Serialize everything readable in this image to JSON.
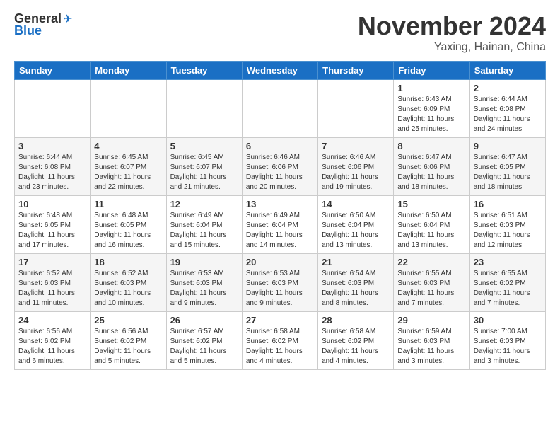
{
  "header": {
    "logo_general": "General",
    "logo_blue": "Blue",
    "title": "November 2024",
    "location": "Yaxing, Hainan, China"
  },
  "weekdays": [
    "Sunday",
    "Monday",
    "Tuesday",
    "Wednesday",
    "Thursday",
    "Friday",
    "Saturday"
  ],
  "weeks": [
    [
      {
        "day": "",
        "info": ""
      },
      {
        "day": "",
        "info": ""
      },
      {
        "day": "",
        "info": ""
      },
      {
        "day": "",
        "info": ""
      },
      {
        "day": "",
        "info": ""
      },
      {
        "day": "1",
        "info": "Sunrise: 6:43 AM\nSunset: 6:09 PM\nDaylight: 11 hours and 25 minutes."
      },
      {
        "day": "2",
        "info": "Sunrise: 6:44 AM\nSunset: 6:08 PM\nDaylight: 11 hours and 24 minutes."
      }
    ],
    [
      {
        "day": "3",
        "info": "Sunrise: 6:44 AM\nSunset: 6:08 PM\nDaylight: 11 hours and 23 minutes."
      },
      {
        "day": "4",
        "info": "Sunrise: 6:45 AM\nSunset: 6:07 PM\nDaylight: 11 hours and 22 minutes."
      },
      {
        "day": "5",
        "info": "Sunrise: 6:45 AM\nSunset: 6:07 PM\nDaylight: 11 hours and 21 minutes."
      },
      {
        "day": "6",
        "info": "Sunrise: 6:46 AM\nSunset: 6:06 PM\nDaylight: 11 hours and 20 minutes."
      },
      {
        "day": "7",
        "info": "Sunrise: 6:46 AM\nSunset: 6:06 PM\nDaylight: 11 hours and 19 minutes."
      },
      {
        "day": "8",
        "info": "Sunrise: 6:47 AM\nSunset: 6:06 PM\nDaylight: 11 hours and 18 minutes."
      },
      {
        "day": "9",
        "info": "Sunrise: 6:47 AM\nSunset: 6:05 PM\nDaylight: 11 hours and 18 minutes."
      }
    ],
    [
      {
        "day": "10",
        "info": "Sunrise: 6:48 AM\nSunset: 6:05 PM\nDaylight: 11 hours and 17 minutes."
      },
      {
        "day": "11",
        "info": "Sunrise: 6:48 AM\nSunset: 6:05 PM\nDaylight: 11 hours and 16 minutes."
      },
      {
        "day": "12",
        "info": "Sunrise: 6:49 AM\nSunset: 6:04 PM\nDaylight: 11 hours and 15 minutes."
      },
      {
        "day": "13",
        "info": "Sunrise: 6:49 AM\nSunset: 6:04 PM\nDaylight: 11 hours and 14 minutes."
      },
      {
        "day": "14",
        "info": "Sunrise: 6:50 AM\nSunset: 6:04 PM\nDaylight: 11 hours and 13 minutes."
      },
      {
        "day": "15",
        "info": "Sunrise: 6:50 AM\nSunset: 6:04 PM\nDaylight: 11 hours and 13 minutes."
      },
      {
        "day": "16",
        "info": "Sunrise: 6:51 AM\nSunset: 6:03 PM\nDaylight: 11 hours and 12 minutes."
      }
    ],
    [
      {
        "day": "17",
        "info": "Sunrise: 6:52 AM\nSunset: 6:03 PM\nDaylight: 11 hours and 11 minutes."
      },
      {
        "day": "18",
        "info": "Sunrise: 6:52 AM\nSunset: 6:03 PM\nDaylight: 11 hours and 10 minutes."
      },
      {
        "day": "19",
        "info": "Sunrise: 6:53 AM\nSunset: 6:03 PM\nDaylight: 11 hours and 9 minutes."
      },
      {
        "day": "20",
        "info": "Sunrise: 6:53 AM\nSunset: 6:03 PM\nDaylight: 11 hours and 9 minutes."
      },
      {
        "day": "21",
        "info": "Sunrise: 6:54 AM\nSunset: 6:03 PM\nDaylight: 11 hours and 8 minutes."
      },
      {
        "day": "22",
        "info": "Sunrise: 6:55 AM\nSunset: 6:03 PM\nDaylight: 11 hours and 7 minutes."
      },
      {
        "day": "23",
        "info": "Sunrise: 6:55 AM\nSunset: 6:02 PM\nDaylight: 11 hours and 7 minutes."
      }
    ],
    [
      {
        "day": "24",
        "info": "Sunrise: 6:56 AM\nSunset: 6:02 PM\nDaylight: 11 hours and 6 minutes."
      },
      {
        "day": "25",
        "info": "Sunrise: 6:56 AM\nSunset: 6:02 PM\nDaylight: 11 hours and 5 minutes."
      },
      {
        "day": "26",
        "info": "Sunrise: 6:57 AM\nSunset: 6:02 PM\nDaylight: 11 hours and 5 minutes."
      },
      {
        "day": "27",
        "info": "Sunrise: 6:58 AM\nSunset: 6:02 PM\nDaylight: 11 hours and 4 minutes."
      },
      {
        "day": "28",
        "info": "Sunrise: 6:58 AM\nSunset: 6:02 PM\nDaylight: 11 hours and 4 minutes."
      },
      {
        "day": "29",
        "info": "Sunrise: 6:59 AM\nSunset: 6:03 PM\nDaylight: 11 hours and 3 minutes."
      },
      {
        "day": "30",
        "info": "Sunrise: 7:00 AM\nSunset: 6:03 PM\nDaylight: 11 hours and 3 minutes."
      }
    ]
  ]
}
